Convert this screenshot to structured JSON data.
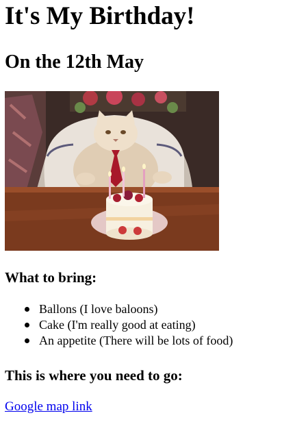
{
  "page": {
    "title": "It's My Birthday!",
    "date_heading": "On the 12th May"
  },
  "image": {
    "subject": "cat-with-birthday-cake"
  },
  "bring": {
    "heading": "What to bring:",
    "items": [
      "Ballons (I love baloons)",
      "Cake (I'm really good at eating)",
      "An appetite (There will be lots of food)"
    ]
  },
  "location": {
    "heading": "This is where you need to go:",
    "link_label": "Google map link"
  },
  "colors": {
    "link": "#0000ee",
    "text": "#000000",
    "background": "#ffffff"
  }
}
